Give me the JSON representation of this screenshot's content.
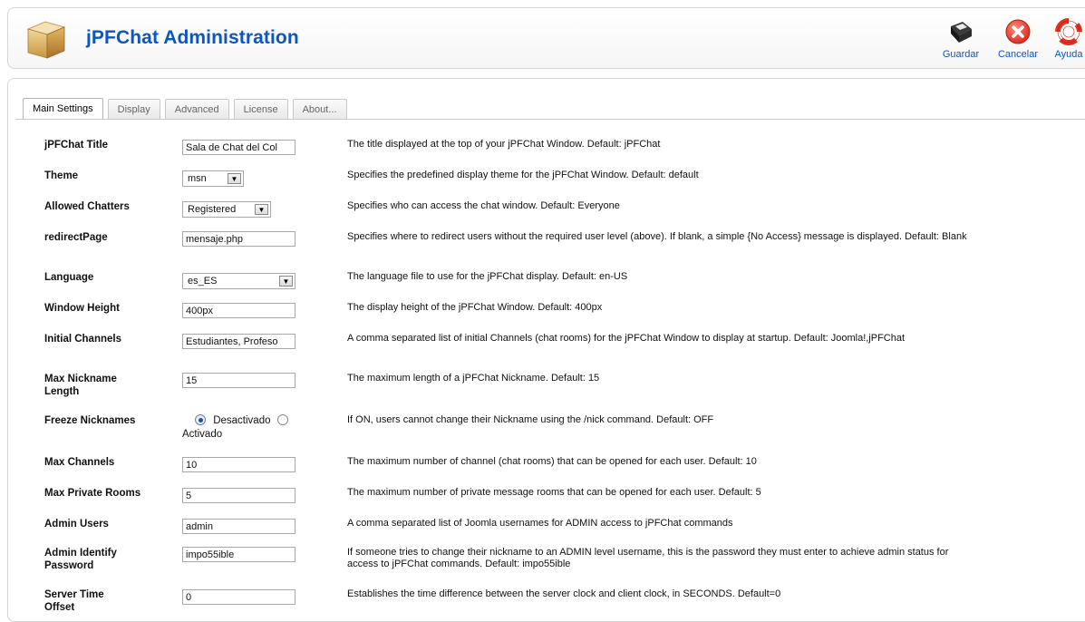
{
  "header": {
    "title": "jPFChat Administration",
    "logo_icon": "package-box-icon",
    "toolbar": [
      {
        "label": "Guardar",
        "icon": "save-icon"
      },
      {
        "label": "Cancelar",
        "icon": "cancel-icon"
      },
      {
        "label": "Ayuda",
        "icon": "help-lifebuoy-icon"
      }
    ]
  },
  "tabs": [
    "Main Settings",
    "Display",
    "Advanced",
    "License",
    "About..."
  ],
  "active_tab": "Main Settings",
  "settings": [
    {
      "label": "jPFChat Title",
      "type": "text",
      "value": "Sala de Chat del Col",
      "description": "The title displayed at the top of your jPFChat Window. Default: jPFChat"
    },
    {
      "label": "Theme",
      "type": "select",
      "value": "msn",
      "description": "Specifies the predefined display theme for the jPFChat Window. Default: default"
    },
    {
      "label": "Allowed Chatters",
      "type": "select",
      "value": "Registered",
      "description": "Specifies who can access the chat window. Default: Everyone"
    },
    {
      "label": "redirectPage",
      "type": "text",
      "value": "mensaje.php",
      "description": "Specifies where to redirect users without the required user level (above). If blank, a simple {No Access} message is displayed. Default: Blank"
    },
    {
      "label": "Language",
      "type": "select",
      "value": "es_ES",
      "description": "The language file to use for the jPFChat display. Default: en-US"
    },
    {
      "label": "Window Height",
      "type": "text",
      "value": "400px",
      "description": "The display height of the jPFChat Window. Default: 400px"
    },
    {
      "label": "Initial Channels",
      "type": "text",
      "value": "Estudiantes, Profeso",
      "description": "A comma separated list of initial Channels (chat rooms) for the jPFChat Window to display at startup. Default: Joomla!,jPFChat"
    },
    {
      "label": "Max Nickname Length",
      "type": "text",
      "value": "15",
      "description": "The maximum length of a jPFChat Nickname. Default: 15"
    },
    {
      "label": "Freeze Nicknames",
      "type": "radio",
      "options": [
        "Desactivado",
        "Activado"
      ],
      "selected": "Desactivado",
      "description": "If ON, users cannot change their Nickname using the /nick command. Default: OFF"
    },
    {
      "label": "Max Channels",
      "type": "text",
      "value": "10",
      "description": "The maximum number of channel (chat rooms) that can be opened for each user. Default: 10"
    },
    {
      "label": "Max Private Rooms",
      "type": "text",
      "value": "5",
      "description": "The maximum number of private message rooms that can be opened for each user. Default: 5"
    },
    {
      "label": "Admin Users",
      "type": "text",
      "value": "admin",
      "description": "A comma separated list of Joomla usernames for ADMIN access to jPFChat commands"
    },
    {
      "label": "Admin Identify Password",
      "type": "text",
      "value": "impo55ible",
      "description": "If someone tries to change their nickname to an ADMIN level username, this is the password they must enter to achieve admin status for access to jPFChat commands. Default: impo55ible"
    },
    {
      "label": "Server Time Offset",
      "type": "text",
      "value": "0",
      "description": "Establishes the time difference between the server clock and client clock, in SECONDS. Default=0"
    }
  ]
}
